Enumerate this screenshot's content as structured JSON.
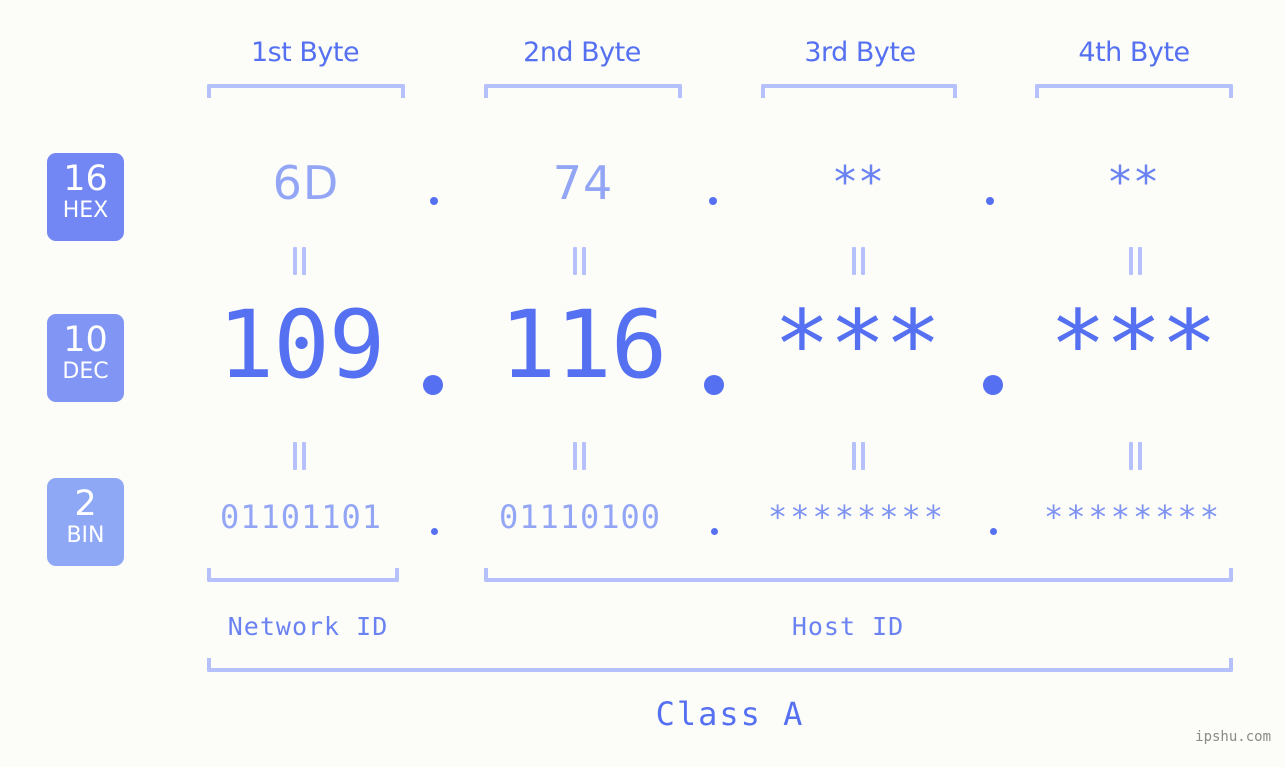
{
  "meta": {
    "background_color": "#fcfdf8",
    "accent_color": "#5570f1",
    "accent_light": "#93a6f5",
    "bracket_color": "#b6c1fb",
    "watermark": "ipshu.com"
  },
  "byte_headers": [
    {
      "label": "1st Byte"
    },
    {
      "label": "2nd Byte"
    },
    {
      "label": "3rd Byte"
    },
    {
      "label": "4th Byte"
    }
  ],
  "bases": [
    {
      "num": "16",
      "name": "HEX",
      "color": "#7287f3"
    },
    {
      "num": "10",
      "name": "DEC",
      "color": "#8095f4"
    },
    {
      "num": "2",
      "name": "BIN",
      "color": "#8fa8f6"
    }
  ],
  "rows": {
    "hex": {
      "base_num": "16",
      "base_name": "HEX",
      "values": [
        "6D",
        "74",
        "**",
        "**"
      ],
      "separator": "."
    },
    "dec": {
      "base_num": "10",
      "base_name": "DEC",
      "values": [
        "109",
        "116",
        "***",
        "***"
      ],
      "separator": "."
    },
    "bin": {
      "base_num": "2",
      "base_name": "BIN",
      "values": [
        "01101101",
        "01110100",
        "********",
        "********"
      ],
      "separator": "."
    }
  },
  "equals_symbol": "=",
  "segments": {
    "network_id": "Network ID",
    "host_id": "Host ID",
    "class": "Class A"
  }
}
